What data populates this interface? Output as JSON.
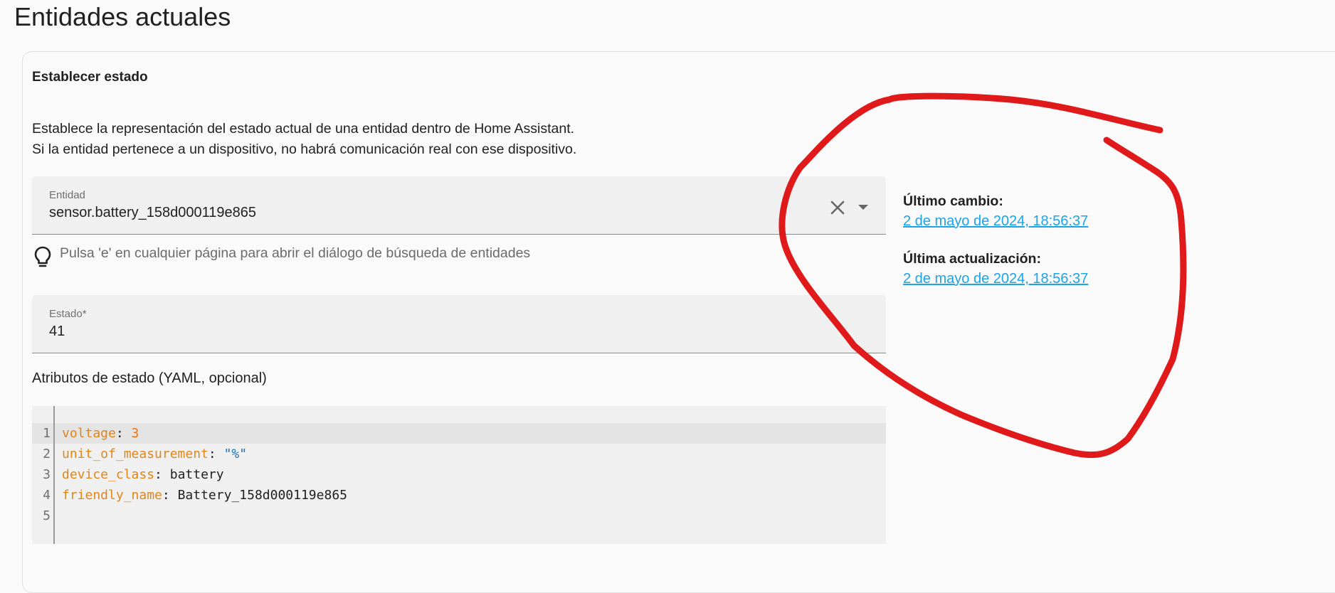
{
  "page": {
    "title": "Entidades actuales"
  },
  "set_state": {
    "title": "Establecer estado",
    "description_line1": "Establece la representación del estado actual de una entidad dentro de Home Assistant.",
    "description_line2": "Si la entidad pertenece a un dispositivo, no habrá comunicación real con ese dispositivo.",
    "entity_field": {
      "label": "Entidad",
      "value": "sensor.battery_158d000119e865"
    },
    "hint": "Pulsa 'e' en cualquier página para abrir el diálogo de búsqueda de entidades",
    "state_field": {
      "label": "Estado*",
      "value": "41"
    },
    "attributes_label": "Atributos de estado (YAML, opcional)",
    "yaml_lines": [
      {
        "n": "1",
        "key": "voltage",
        "sep": ": ",
        "value": "3",
        "kind": "num"
      },
      {
        "n": "2",
        "key": "unit_of_measurement",
        "sep": ": ",
        "value": "\"%\"",
        "kind": "str"
      },
      {
        "n": "3",
        "key": "device_class",
        "sep": ": ",
        "value": "battery",
        "kind": "plain"
      },
      {
        "n": "4",
        "key": "friendly_name",
        "sep": ": ",
        "value": "Battery_158d000119e865",
        "kind": "plain"
      },
      {
        "n": "5",
        "key": "",
        "sep": "",
        "value": "",
        "kind": "plain"
      }
    ]
  },
  "timestamps": {
    "last_changed_label": "Último cambio:",
    "last_changed_value": "2 de mayo de 2024, 18:56:37",
    "last_updated_label": "Última actualización:",
    "last_updated_value": "2 de mayo de 2024, 18:56:37"
  },
  "icons": {
    "clear": "close-icon",
    "dropdown": "caret-down-icon",
    "hint": "lightbulb-icon"
  },
  "colors": {
    "link": "#1aa5e8",
    "annotation": "#e0191b",
    "yaml_key": "#e0861a",
    "yaml_number": "#e8741a",
    "yaml_string": "#1c6fb3"
  }
}
